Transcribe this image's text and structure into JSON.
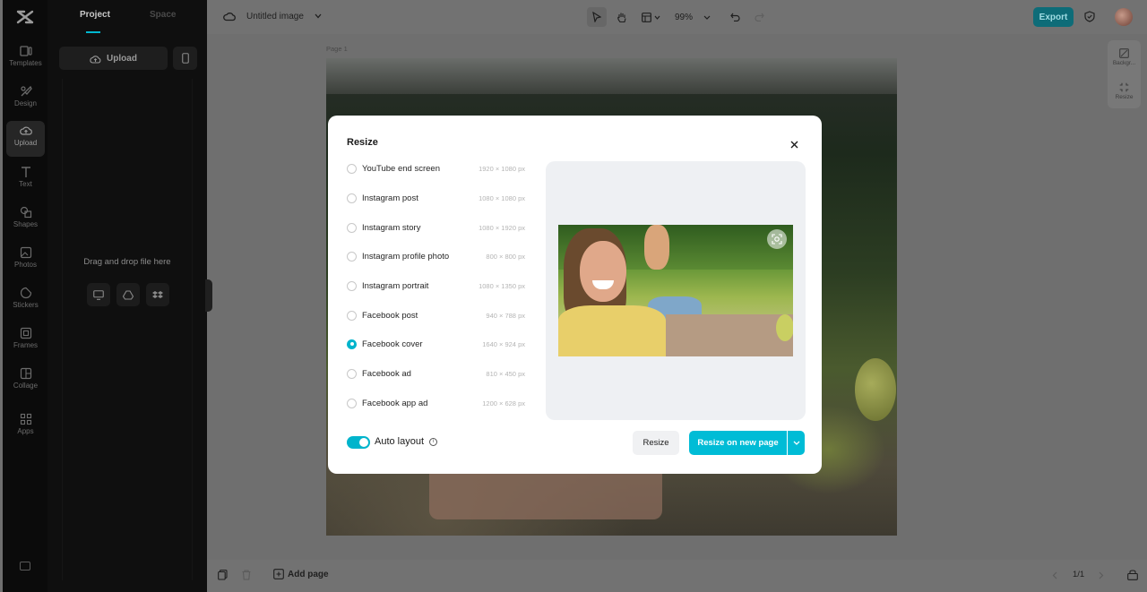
{
  "sidebar": {
    "items": [
      {
        "label": "Templates",
        "icon": "templates-icon"
      },
      {
        "label": "Design",
        "icon": "design-icon"
      },
      {
        "label": "Upload",
        "icon": "upload-cloud-icon",
        "active": true
      },
      {
        "label": "Text",
        "icon": "text-icon"
      },
      {
        "label": "Shapes",
        "icon": "shapes-icon"
      },
      {
        "label": "Photos",
        "icon": "photos-icon"
      },
      {
        "label": "Stickers",
        "icon": "stickers-icon"
      },
      {
        "label": "Frames",
        "icon": "frames-icon"
      },
      {
        "label": "Collage",
        "icon": "collage-icon"
      },
      {
        "label": "Apps",
        "icon": "apps-icon"
      }
    ]
  },
  "panel": {
    "tabs": [
      {
        "label": "Project",
        "active": true
      },
      {
        "label": "Space",
        "active": false
      }
    ],
    "upload_label": "Upload",
    "drop_text": "Drag and drop file here"
  },
  "topbar": {
    "title": "Untitled image",
    "zoom": "99%",
    "export_label": "Export"
  },
  "canvas": {
    "page_label": "Page 1"
  },
  "right_tools": {
    "background_label": "Backgr...",
    "resize_label": "Resize"
  },
  "bottombar": {
    "add_page_label": "Add page",
    "pager": "1/1"
  },
  "modal": {
    "title": "Resize",
    "options": [
      {
        "label": "YouTube end screen",
        "size": "1920 × 1080 px",
        "selected": false
      },
      {
        "label": "Instagram post",
        "size": "1080 × 1080 px",
        "selected": false
      },
      {
        "label": "Instagram story",
        "size": "1080 × 1920 px",
        "selected": false
      },
      {
        "label": "Instagram profile photo",
        "size": "800 × 800 px",
        "selected": false
      },
      {
        "label": "Instagram portrait",
        "size": "1080 × 1350 px",
        "selected": false
      },
      {
        "label": "Facebook post",
        "size": "940 × 788 px",
        "selected": false
      },
      {
        "label": "Facebook cover",
        "size": "1640 × 924 px",
        "selected": true
      },
      {
        "label": "Facebook ad",
        "size": "810 × 450 px",
        "selected": false
      },
      {
        "label": "Facebook app ad",
        "size": "1200 × 628 px",
        "selected": false
      }
    ],
    "auto_layout_label": "Auto layout",
    "auto_layout_on": true,
    "resize_label": "Resize",
    "resize_new_label": "Resize on new page"
  },
  "colors": {
    "accent": "#00bcd6",
    "overlay": "#6f6f6f"
  }
}
